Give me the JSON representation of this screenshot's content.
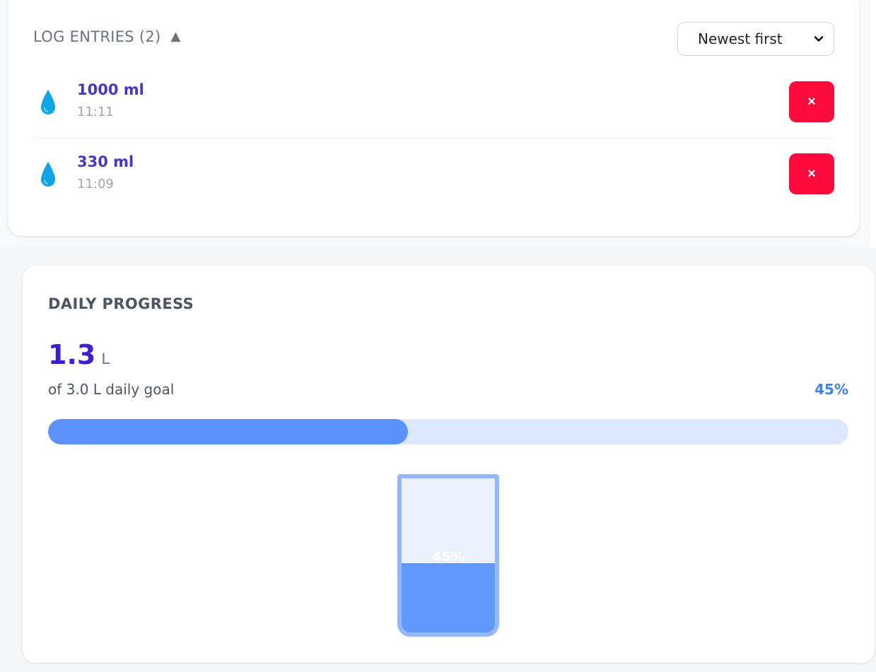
{
  "log": {
    "title": "LOG ENTRIES (2)",
    "collapse_glyph": "▲",
    "sort": {
      "selected": "Newest first"
    },
    "entries": [
      {
        "amount": "1000 ml",
        "time": "11:11",
        "icon": "water-drop-icon",
        "delete_glyph": "×"
      },
      {
        "amount": "330 ml",
        "time": "11:09",
        "icon": "water-drop-icon",
        "delete_glyph": "×"
      }
    ]
  },
  "progress": {
    "title": "DAILY PROGRESS",
    "value": "1.3",
    "unit": "L",
    "goal_text": "of 3.0 L daily goal",
    "percent_text": "45%",
    "percent": 45,
    "glass_label": "45%"
  },
  "colors": {
    "accent": "#3b1fd6",
    "progress_fill": "#5b93fb",
    "progress_track": "#dbe7fd",
    "delete": "#ff0a3c",
    "drop": "#0ea5e9"
  }
}
